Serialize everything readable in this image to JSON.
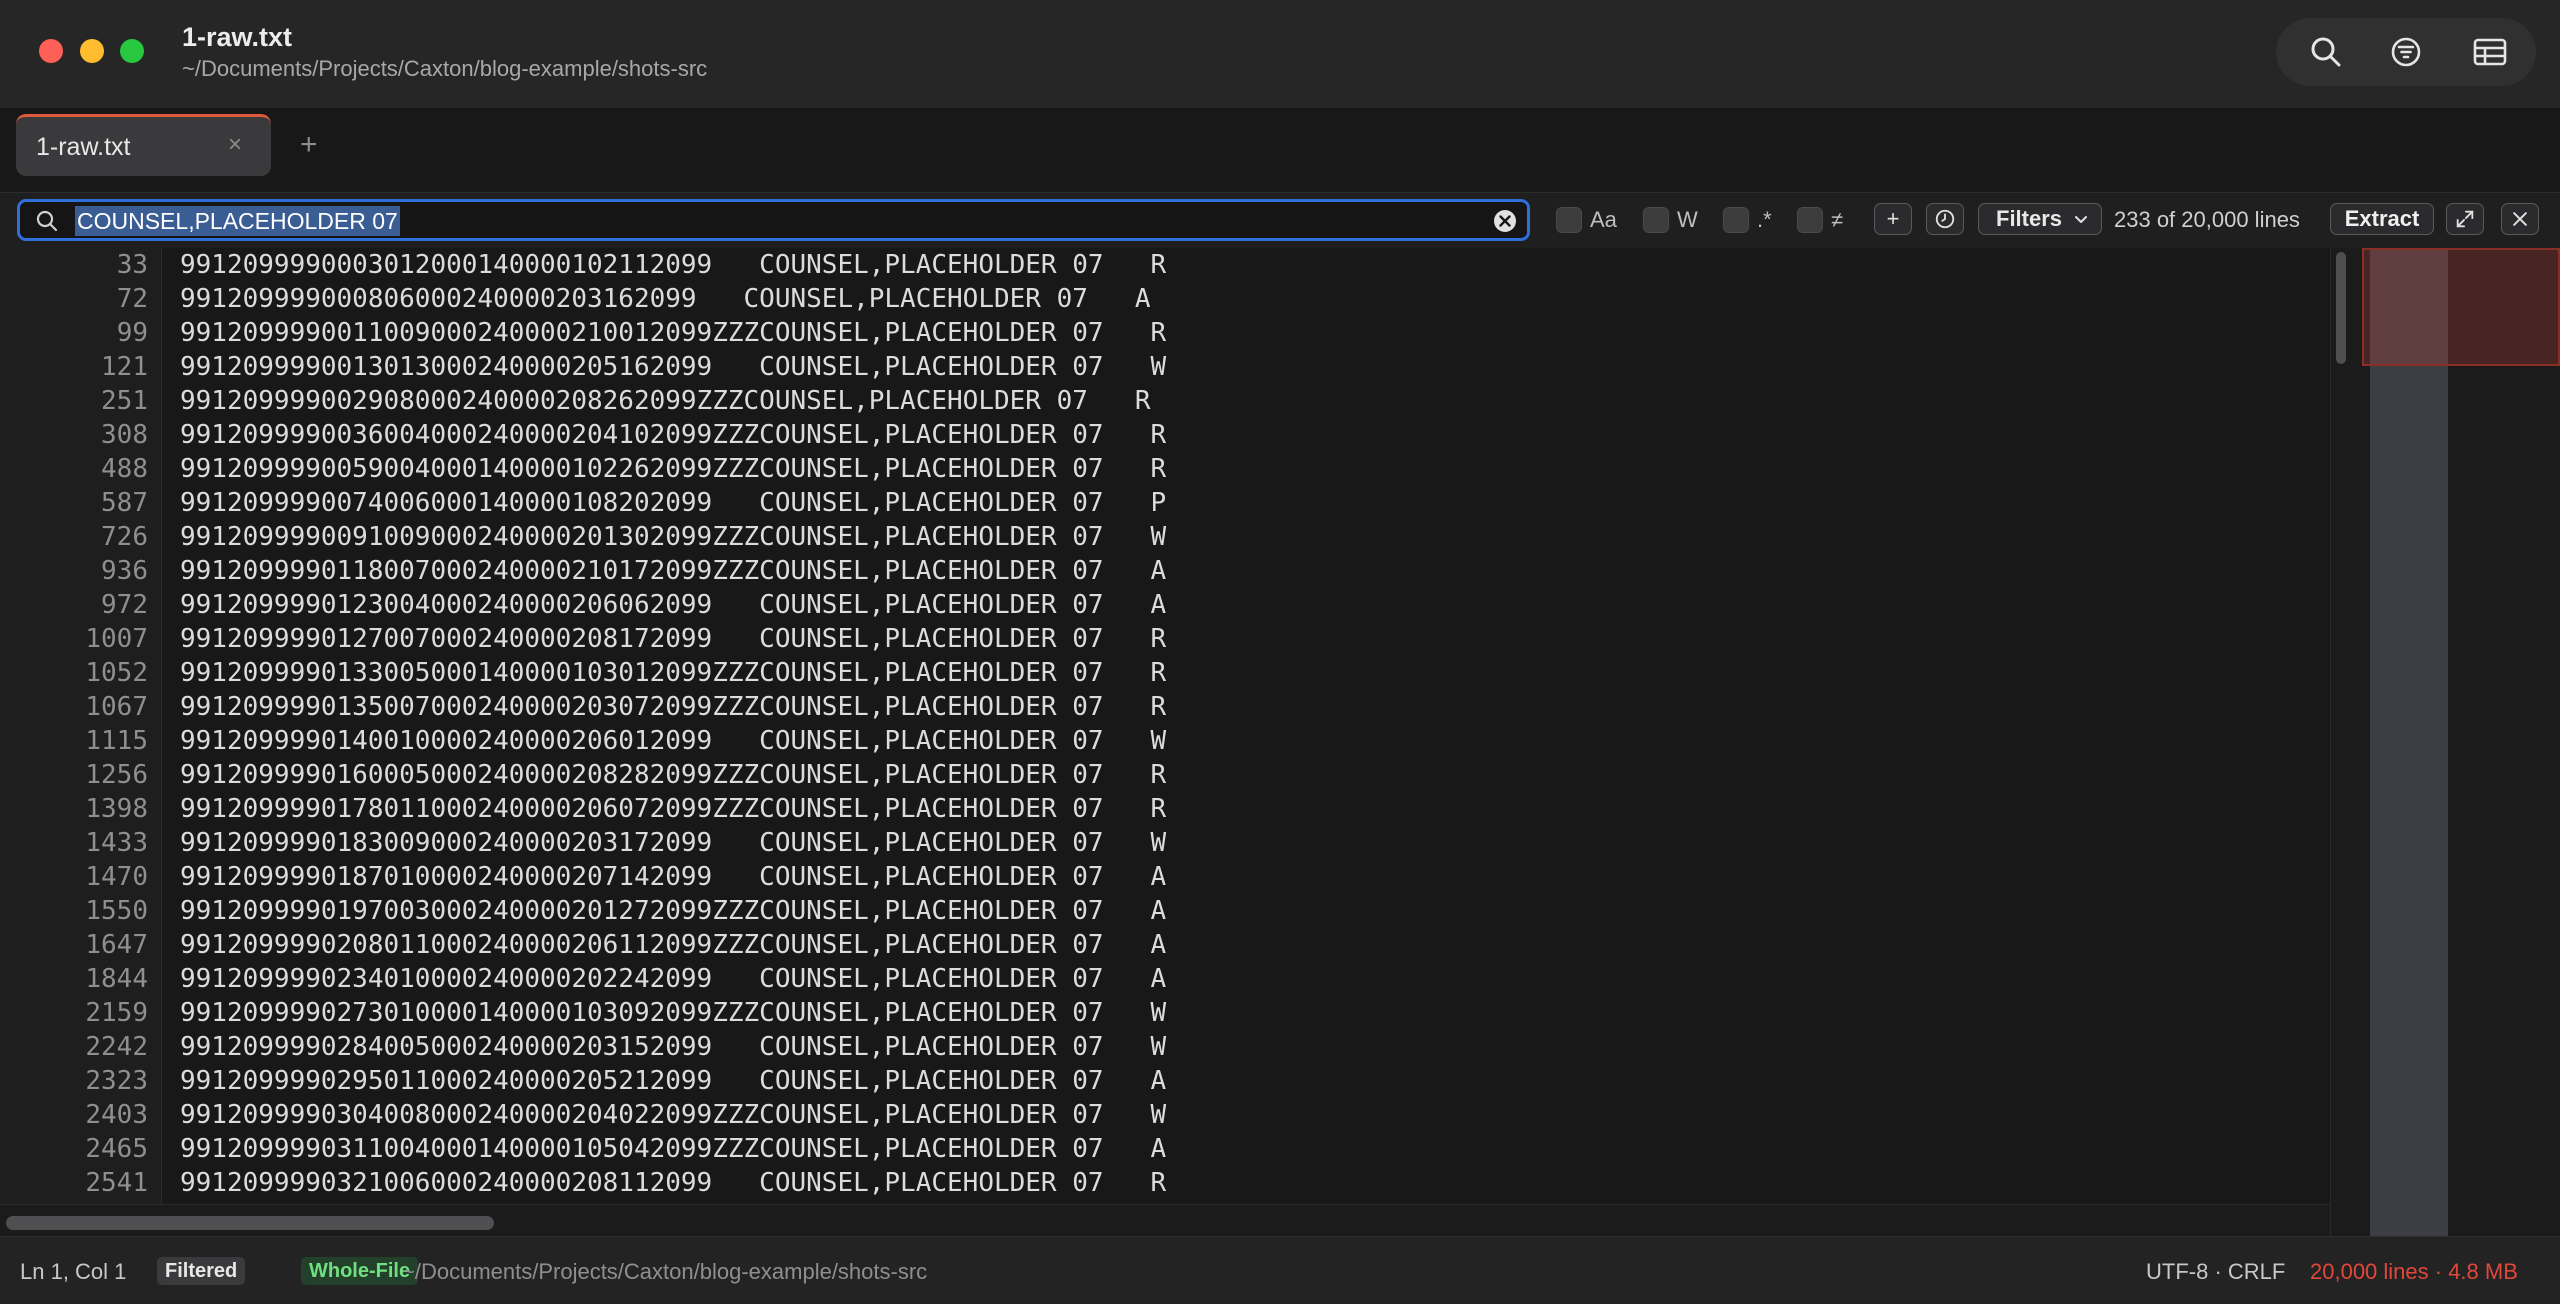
{
  "window": {
    "title": "1-raw.txt",
    "path": "~/Documents/Projects/Caxton/blog-example/shots-src"
  },
  "toolbar": {
    "icons": [
      "search-icon",
      "filter-icon",
      "table-icon"
    ]
  },
  "tabs": [
    {
      "label": "1-raw.txt",
      "close": "×",
      "active": true
    }
  ],
  "tab_add": "+",
  "search": {
    "value": "COUNSEL,PLACEHOLDER 07",
    "options": [
      {
        "label": "Aa",
        "checked": false
      },
      {
        "label": "W",
        "checked": false
      },
      {
        "label": ".*",
        "checked": false
      },
      {
        "label": "≠",
        "checked": false
      }
    ],
    "add_label": "+",
    "filters_label": "Filters",
    "match_count": "233 of 20,000 lines",
    "extract_label": "Extract",
    "expand_icon": "expand-icon",
    "close_icon": "close-icon"
  },
  "lines": [
    {
      "n": "33",
      "text": "99120999900030120001400001021120 99   COUNSEL,PLACEHOLDER 07   R"
    },
    {
      "n": "72",
      "text": "991209999000806000240000203162099   COUNSEL,PLACEHOLDER 07   A"
    },
    {
      "n": "99",
      "text": "991209999001100900024000021001209 9ZZZCOUNSEL,PLACEHOLDER 07   R"
    },
    {
      "n": "121",
      "text": "991209999001301300024000020516209 9   COUNSEL,PLACEHOLDER 07   W"
    },
    {
      "n": "251",
      "text": "991209999002908000240000208262099ZZZCOUNSEL,PLACEHOLDER 07   R"
    },
    {
      "n": "308",
      "text": "991209999003600400024000020410209 9ZZZCOUNSEL,PLACEHOLDER 07   R"
    },
    {
      "n": "488",
      "text": "991209999005900400014000010226209 9ZZZCOUNSEL,PLACEHOLDER 07   R"
    },
    {
      "n": "587",
      "text": "991209999007400600014000010820209 9   COUNSEL,PLACEHOLDER 07   P"
    },
    {
      "n": "726",
      "text": "991209999009100900024000020130209 9ZZZCOUNSEL,PLACEHOLDER 07   W"
    },
    {
      "n": "936",
      "text": "991209999011800700024000021017209 9ZZZCOUNSEL,PLACEHOLDER 07   A"
    },
    {
      "n": "972",
      "text": "991209999012300400024000020606209 9   COUNSEL,PLACEHOLDER 07   A"
    },
    {
      "n": "1007",
      "text": "991209999012700700024000020817209 9   COUNSEL,PLACEHOLDER 07   R"
    },
    {
      "n": "1052",
      "text": "991209999013300500014000010301209 9ZZZCOUNSEL,PLACEHOLDER 07   R"
    },
    {
      "n": "1067",
      "text": "991209999013500700024000020307209 9ZZZCOUNSEL,PLACEHOLDER 07   R"
    },
    {
      "n": "1115",
      "text": "991209999014001000024000020601209 9   COUNSEL,PLACEHOLDER 07   W"
    },
    {
      "n": "1256",
      "text": "991209999016000500024000020828209 9ZZZCOUNSEL,PLACEHOLDER 07   R"
    },
    {
      "n": "1398",
      "text": "991209999017801100024000020607209 9ZZZCOUNSEL,PLACEHOLDER 07   R"
    },
    {
      "n": "1433",
      "text": "991209999018300900024000020317209 9   COUNSEL,PLACEHOLDER 07   W"
    },
    {
      "n": "1470",
      "text": "991209999018701000024000020714209 9   COUNSEL,PLACEHOLDER 07   A"
    },
    {
      "n": "1550",
      "text": "991209999019700300024000020127209 9ZZZCOUNSEL,PLACEHOLDER 07   A"
    },
    {
      "n": "1647",
      "text": "991209999020801100024000020611209 9ZZZCOUNSEL,PLACEHOLDER 07   A"
    },
    {
      "n": "1844",
      "text": "991209999023401000024000020224209 9   COUNSEL,PLACEHOLDER 07   A"
    },
    {
      "n": "2159",
      "text": "991209999027301000014000010309209 9ZZZCOUNSEL,PLACEHOLDER 07   W"
    },
    {
      "n": "2242",
      "text": "991209999028400500024000020315209 9   COUNSEL,PLACEHOLDER 07   W"
    },
    {
      "n": "2323",
      "text": "991209999029501100024000020521209 9   COUNSEL,PLACEHOLDER 07   A"
    },
    {
      "n": "2403",
      "text": "991209999030400800024000020402209 9ZZZCOUNSEL,PLACEHOLDER 07   W"
    },
    {
      "n": "2465",
      "text": "991209999031100400014000010504209 9ZZZCOUNSEL,PLACEHOLDER 07   A"
    },
    {
      "n": "2541",
      "text": "991209999032100600024000020811209 9   COUNSEL,PLACEHOLDER 07   R"
    }
  ],
  "status": {
    "position": "Ln 1, Col 1",
    "badge_filtered": "Filtered",
    "badge_whole_file": "Whole-File",
    "path": "~/Documents/Projects/Caxton/blog-example/shots-src",
    "encoding": "UTF-8 · CRLF",
    "size": "20,000 lines · 4.8 MB"
  },
  "colors": {
    "accent": "#2e6fdc",
    "tab_indicator": "#e05a3c",
    "size_warning": "#e0483a",
    "whole_file_badge": "#6fe07f"
  }
}
